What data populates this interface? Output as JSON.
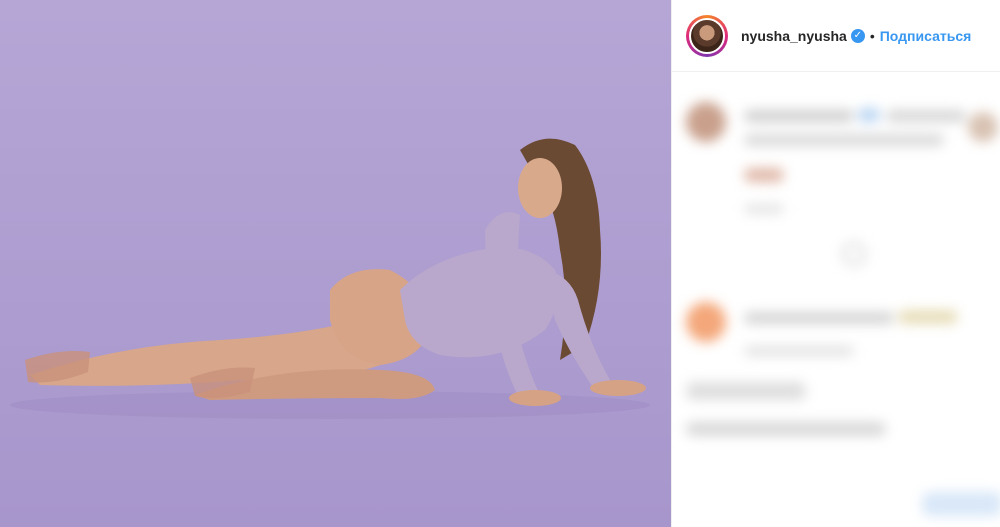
{
  "post": {
    "username": "nyusha_nyusha",
    "verified_icon": "verified-badge-icon",
    "separator": "•",
    "follow_label": "Подписаться"
  },
  "colors": {
    "photo_background": "#b1a1d3",
    "link_blue": "#3897f0"
  }
}
